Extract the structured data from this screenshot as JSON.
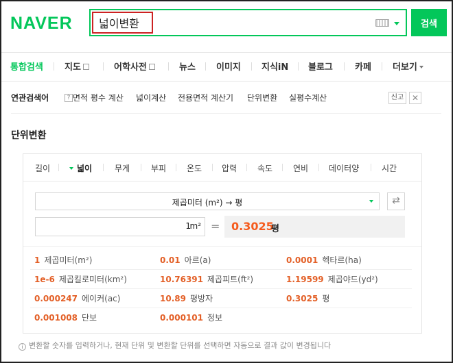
{
  "header": {
    "logo": "NAVER",
    "search_value": "넓이변환",
    "search_button": "검색"
  },
  "tabs": [
    {
      "label": "통합검색",
      "active": true
    },
    {
      "label": "지도"
    },
    {
      "label": "어학사전"
    },
    {
      "label": "뉴스"
    },
    {
      "label": "이미지"
    },
    {
      "label": "지식iN"
    },
    {
      "label": "블로그"
    },
    {
      "label": "카페"
    },
    {
      "label": "더보기"
    }
  ],
  "related": {
    "title": "연관검색어",
    "help": "?",
    "items": [
      "면적 평수 계산",
      "넓이계산",
      "전용면적 계산기",
      "단위변환",
      "실평수계산"
    ],
    "report": "신고",
    "close": "✕"
  },
  "section_title": "단위변환",
  "converter": {
    "categories": [
      "길이",
      "넓이",
      "무게",
      "부피",
      "온도",
      "압력",
      "속도",
      "연비",
      "데이터양",
      "시간"
    ],
    "active_category": "넓이",
    "selected_conversion": "제곱미터 (m²) → 평",
    "swap": "⇄",
    "input_value": "1",
    "input_unit": "m²",
    "equals": "=",
    "result_value": "0.3025",
    "result_unit": "평",
    "results": [
      {
        "value": "1",
        "label": "제곱미터(m²)"
      },
      {
        "value": "0.01",
        "label": "아르(a)"
      },
      {
        "value": "0.0001",
        "label": "헥타르(ha)"
      },
      {
        "value": "1e-6",
        "label": "제곱킬로미터(km²)"
      },
      {
        "value": "10.76391",
        "label": "제곱피트(ft²)"
      },
      {
        "value": "1.19599",
        "label": "제곱야드(yd²)"
      },
      {
        "value": "0.000247",
        "label": "에이커(ac)"
      },
      {
        "value": "10.89",
        "label": "평방자"
      },
      {
        "value": "0.3025",
        "label": "평"
      },
      {
        "value": "0.001008",
        "label": "단보"
      },
      {
        "value": "0.000101",
        "label": "정보"
      }
    ]
  },
  "footnote": "변환할 숫자를 입력하거나, 현재 단위 및 변환할 단위를 선택하면 자동으로 결과 값이 변경됩니다",
  "colors": {
    "brand": "#03c75a",
    "result": "#f55b1d",
    "highlight_border": "#cc2222"
  }
}
